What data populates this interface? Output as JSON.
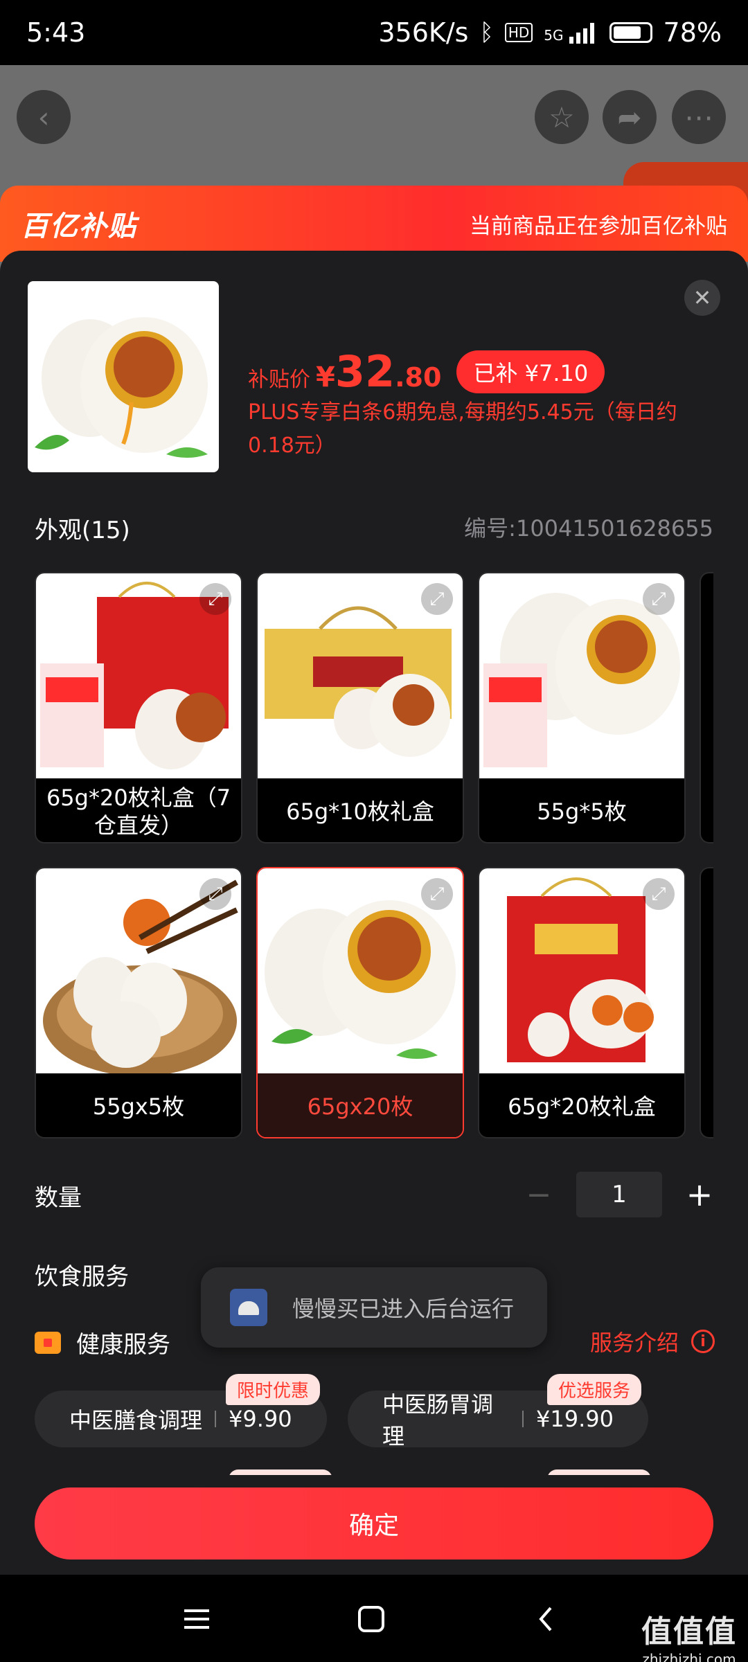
{
  "status_bar": {
    "time": "5:43",
    "net_speed": "356K/s",
    "battery": "78%",
    "signal": "5G"
  },
  "subsidy": {
    "logo": "百亿补贴",
    "note": "当前商品正在参加百亿补贴"
  },
  "price": {
    "label": "补贴价",
    "currency": "¥",
    "integer": "32",
    "decimal": ".80",
    "saved": "已补 ¥7.10"
  },
  "plus_text": "PLUS专享白条6期免息,每期约5.45元（每日约0.18元）",
  "appearance": {
    "title": "外观(15)",
    "sku": "编号:10041501628655"
  },
  "variants": [
    {
      "label": "65g*20枚礼盒（7仓直发）"
    },
    {
      "label": "65g*10枚礼盒"
    },
    {
      "label": "55g*5枚"
    },
    {
      "label": "55gx5枚"
    },
    {
      "label": "65gx20枚"
    },
    {
      "label": "65g*20枚礼盒"
    }
  ],
  "quantity": {
    "label": "数量",
    "value": "1",
    "minus": "−",
    "plus": "+"
  },
  "diet": {
    "title": "饮食服务",
    "health_label": "健康服务",
    "intro": "服务介绍",
    "chips": [
      {
        "name": "中医膳食调理",
        "price": "¥9.90",
        "tag": "限时优惠"
      },
      {
        "name": "中医肠胃调理",
        "price": "¥19.90",
        "tag": "优选服务"
      }
    ]
  },
  "toast": "慢慢买已进入后台运行",
  "confirm": "确定",
  "watermark": {
    "big": "值值值",
    "small": "zhizhizhi.com"
  },
  "colors": {
    "accent": "#ff3b30",
    "sheet": "#1d1d1f"
  }
}
